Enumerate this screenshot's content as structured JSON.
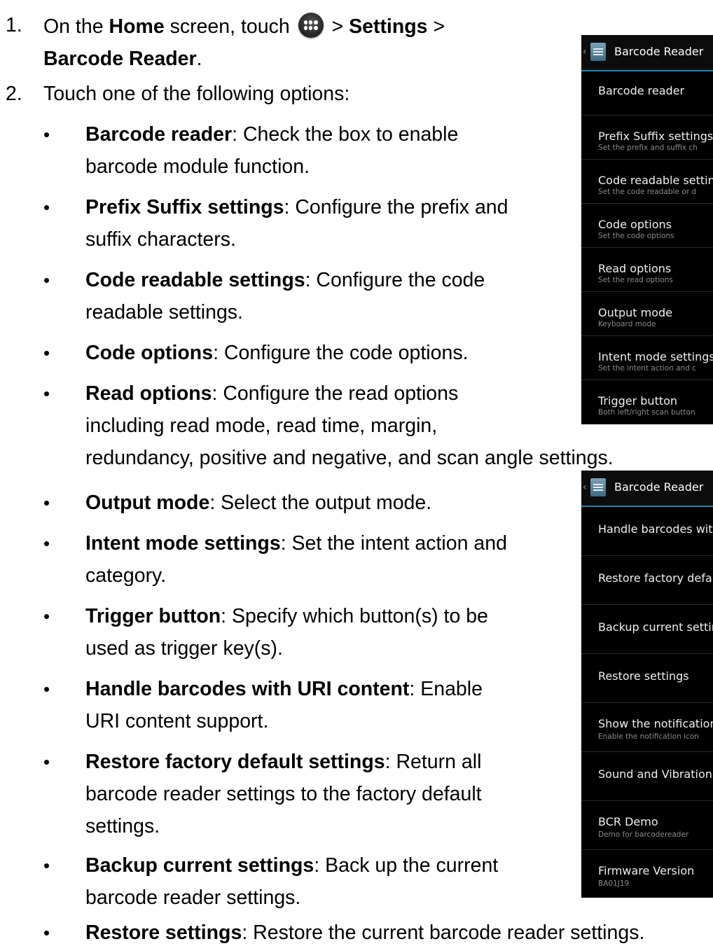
{
  "steps": [
    {
      "number": "1.",
      "line1": {
        "pre": "On the ",
        "home": "Home",
        "mid": " screen, touch ",
        "post": " > ",
        "settings": "Settings",
        "gt": " >"
      },
      "line2": {
        "barcode_reader": "Barcode Reader",
        "dot": "."
      }
    },
    {
      "number": "2.",
      "text": "Touch one of the following options:"
    }
  ],
  "options": [
    {
      "bold": "Barcode reader",
      "rest1": ": Check the box to enable",
      "rest2": "barcode module function."
    },
    {
      "bold": "Prefix Suffix settings",
      "rest1": ": Configure the prefix and",
      "rest2": "suffix characters."
    },
    {
      "bold": "Code readable settings",
      "rest1": ": Configure the code",
      "rest2": "readable settings."
    },
    {
      "bold": "Code options",
      "rest1": ": Configure the code options."
    },
    {
      "bold": "Read options",
      "rest1": ": Configure the read options",
      "rest2": "including read mode, read time, margin,",
      "rest3": "redundancy, positive and negative, and scan angle settings."
    },
    {
      "bold": "Output mode",
      "rest1": ": Select the output mode."
    },
    {
      "bold": "Intent mode settings",
      "rest1": ": Set the intent action and",
      "rest2": "category."
    },
    {
      "bold": "Trigger button",
      "rest1": ": Specify which button(s) to be",
      "rest2": "used as trigger key(s)."
    },
    {
      "bold": "Handle barcodes with URI content",
      "rest1": ": Enable",
      "rest2": "URI content support."
    },
    {
      "bold": "Restore factory default settings",
      "rest1": ": Return all",
      "rest2": "barcode reader settings to the factory default",
      "rest3": "settings."
    },
    {
      "bold": "Backup current settings",
      "rest1": ": Back up the current",
      "rest2": "barcode reader settings."
    },
    {
      "bold": "Restore settings",
      "rest1": ": Restore the current barcode reader settings."
    }
  ],
  "bullet_glyph": "•",
  "screenshot1": {
    "title": "Barcode Reader",
    "items": [
      {
        "title": "Barcode reader",
        "sub": ""
      },
      {
        "title": "Prefix Suffix settings",
        "sub": "Set the prefix and suffix ch"
      },
      {
        "title": "Code readable settin",
        "sub": "Set the code readable or d"
      },
      {
        "title": "Code options",
        "sub": "Set the code options"
      },
      {
        "title": "Read options",
        "sub": "Set the read options"
      },
      {
        "title": "Output mode",
        "sub": "Keyboard mode"
      },
      {
        "title": "Intent mode settings",
        "sub": "Set the intent action and c"
      },
      {
        "title": "Trigger button",
        "sub": "Both left/right scan button"
      }
    ]
  },
  "screenshot2": {
    "title": "Barcode Reader",
    "items": [
      {
        "title": "Handle barcodes with",
        "sub": ""
      },
      {
        "title": "Restore factory defau",
        "sub": ""
      },
      {
        "title": "Backup current settin",
        "sub": ""
      },
      {
        "title": "Restore settings",
        "sub": ""
      },
      {
        "title": "Show the notification",
        "sub": "Enable the notification icon"
      },
      {
        "title": "Sound and Vibration",
        "sub": ""
      },
      {
        "title": "BCR Demo",
        "sub": "Demo for barcodereader"
      },
      {
        "title": "Firmware Version",
        "sub": "BA01J19"
      }
    ]
  },
  "icons": {
    "apps": "apps-grid-icon",
    "back": "chevron-left-icon",
    "app": "barcode-reader-app-icon"
  }
}
